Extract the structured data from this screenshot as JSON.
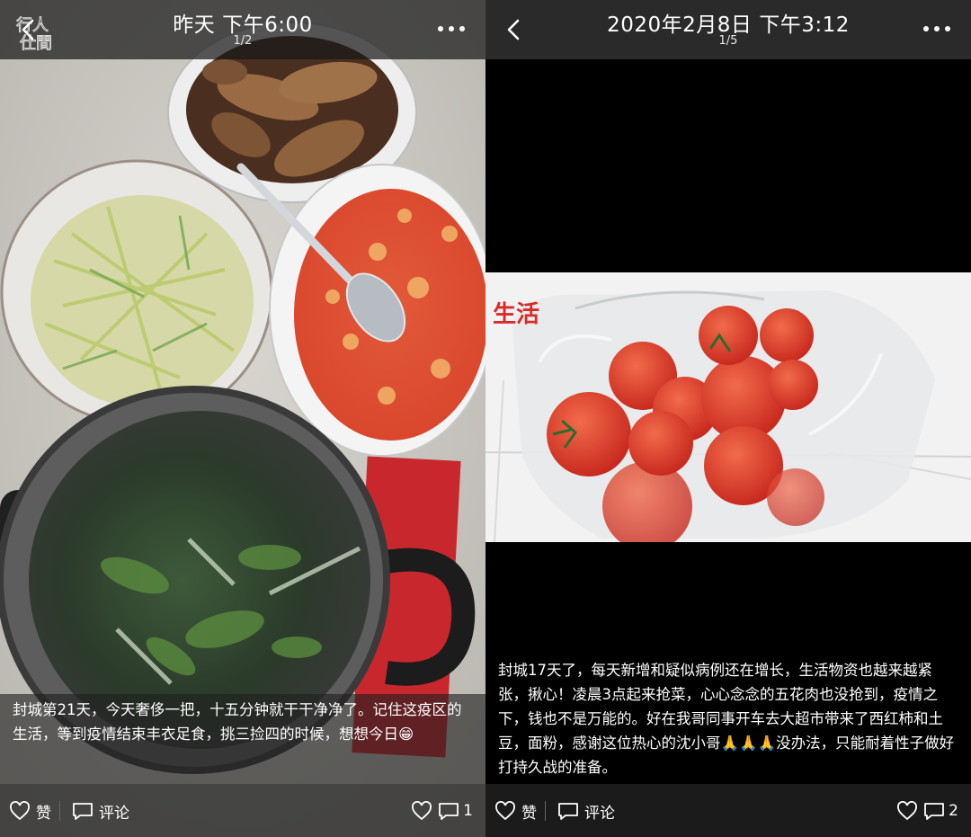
{
  "left": {
    "header": {
      "title": "昨天 下午6:00",
      "counter": "1/2",
      "watermark_text": "行人仕間"
    },
    "caption": "封城第21天，今天奢侈一把，十五分钟就干干净净了。记住这疫区的生活，等到疫情结束丰衣足食，挑三捡四的时候，想想今日😁",
    "footer": {
      "like_label": "赞",
      "comment_label": "评论",
      "like_count": "",
      "comment_count": "1"
    }
  },
  "right": {
    "header": {
      "title": "2020年2月8日 下午3:12",
      "counter": "1/5"
    },
    "caption": "封城17天了，每天新增和疑似病例还在增长，生活物资也越来越紧张，揪心！凌晨3点起来抢菜，心心念念的五花肉也没抢到，疫情之下，钱也不是万能的。好在我哥同事开车去大超市带来了西红柿和土豆，面粉，感谢这位热心的沈小哥🙏🙏🙏没办法，只能耐着性子做好打持久战的准备。",
    "photo_bag_text": "生活",
    "footer": {
      "like_label": "赞",
      "comment_label": "评论",
      "like_count": "",
      "comment_count": "2"
    }
  },
  "icons": [
    "back-icon",
    "more-icon",
    "heart-icon",
    "comment-icon"
  ]
}
